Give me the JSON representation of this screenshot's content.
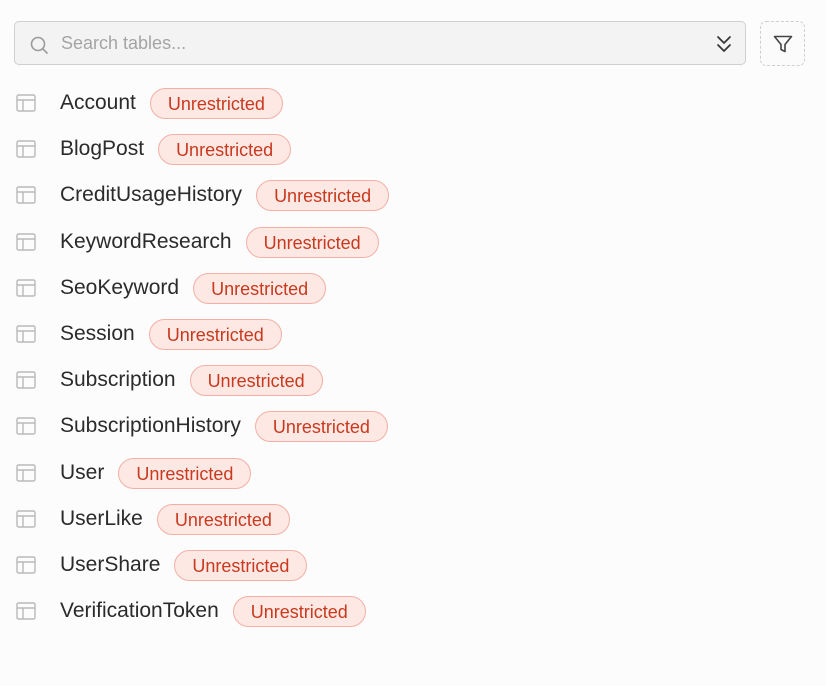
{
  "search": {
    "placeholder": "Search tables...",
    "value": ""
  },
  "icons": {
    "search": "search-icon",
    "expand": "chevrons-down-icon",
    "filter": "filter-icon",
    "table": "table-icon"
  },
  "colors": {
    "badge_text": "#c8391e",
    "badge_bg": "#fde8e4",
    "badge_border": "#f2b0a4"
  },
  "tables": [
    {
      "name": "Account",
      "status": "Unrestricted"
    },
    {
      "name": "BlogPost",
      "status": "Unrestricted"
    },
    {
      "name": "CreditUsageHistory",
      "status": "Unrestricted"
    },
    {
      "name": "KeywordResearch",
      "status": "Unrestricted"
    },
    {
      "name": "SeoKeyword",
      "status": "Unrestricted"
    },
    {
      "name": "Session",
      "status": "Unrestricted"
    },
    {
      "name": "Subscription",
      "status": "Unrestricted"
    },
    {
      "name": "SubscriptionHistory",
      "status": "Unrestricted"
    },
    {
      "name": "User",
      "status": "Unrestricted"
    },
    {
      "name": "UserLike",
      "status": "Unrestricted"
    },
    {
      "name": "UserShare",
      "status": "Unrestricted"
    },
    {
      "name": "VerificationToken",
      "status": "Unrestricted"
    }
  ]
}
